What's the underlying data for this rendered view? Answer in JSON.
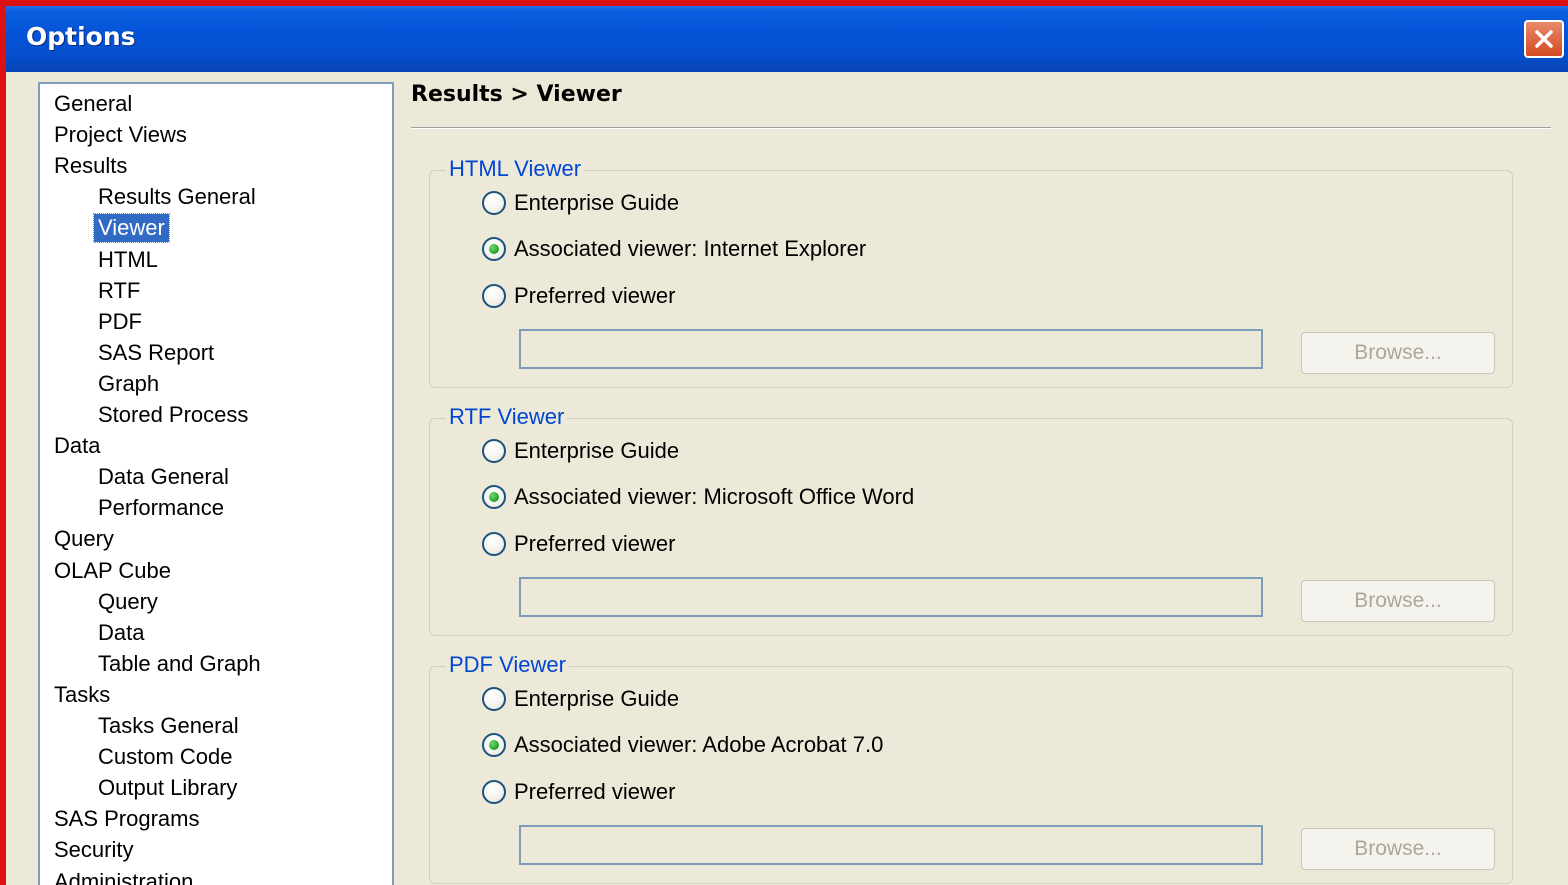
{
  "window": {
    "title": "Options"
  },
  "tree": {
    "items": [
      {
        "label": "General",
        "level": 0
      },
      {
        "label": "Project Views",
        "level": 0
      },
      {
        "label": "Results",
        "level": 0
      },
      {
        "label": "Results General",
        "level": 1
      },
      {
        "label": "Viewer",
        "level": 1,
        "selected": true
      },
      {
        "label": "HTML",
        "level": 1
      },
      {
        "label": "RTF",
        "level": 1
      },
      {
        "label": "PDF",
        "level": 1
      },
      {
        "label": "SAS Report",
        "level": 1
      },
      {
        "label": "Graph",
        "level": 1
      },
      {
        "label": "Stored Process",
        "level": 1
      },
      {
        "label": "Data",
        "level": 0
      },
      {
        "label": "Data General",
        "level": 1
      },
      {
        "label": "Performance",
        "level": 1
      },
      {
        "label": "Query",
        "level": 0
      },
      {
        "label": "OLAP Cube",
        "level": 0
      },
      {
        "label": "Query",
        "level": 1
      },
      {
        "label": "Data",
        "level": 1
      },
      {
        "label": "Table and Graph",
        "level": 1
      },
      {
        "label": "Tasks",
        "level": 0
      },
      {
        "label": "Tasks General",
        "level": 1
      },
      {
        "label": "Custom Code",
        "level": 1
      },
      {
        "label": "Output Library",
        "level": 1
      },
      {
        "label": "SAS Programs",
        "level": 0
      },
      {
        "label": "Security",
        "level": 0
      },
      {
        "label": "Administration",
        "level": 0
      }
    ]
  },
  "breadcrumb": "Results > Viewer",
  "groups": [
    {
      "title": "HTML Viewer",
      "options": [
        {
          "label": "Enterprise Guide",
          "checked": false
        },
        {
          "label": "Associated viewer: Internet Explorer",
          "checked": true
        },
        {
          "label": "Preferred viewer",
          "checked": false
        }
      ],
      "path_value": "",
      "browse_label": "Browse..."
    },
    {
      "title": "RTF Viewer",
      "options": [
        {
          "label": "Enterprise Guide",
          "checked": false
        },
        {
          "label": "Associated viewer: Microsoft Office Word",
          "checked": true
        },
        {
          "label": "Preferred viewer",
          "checked": false
        }
      ],
      "path_value": "",
      "browse_label": "Browse..."
    },
    {
      "title": "PDF Viewer",
      "options": [
        {
          "label": "Enterprise Guide",
          "checked": false
        },
        {
          "label": "Associated viewer: Adobe Acrobat 7.0",
          "checked": true
        },
        {
          "label": "Preferred viewer",
          "checked": false
        }
      ],
      "path_value": "",
      "browse_label": "Browse..."
    }
  ],
  "colors": {
    "titlebar": "#0553d8",
    "selection": "#316ac5",
    "group_title": "#0046d5",
    "radio_selected": "#21a121",
    "window_bg": "#ece9d8"
  }
}
